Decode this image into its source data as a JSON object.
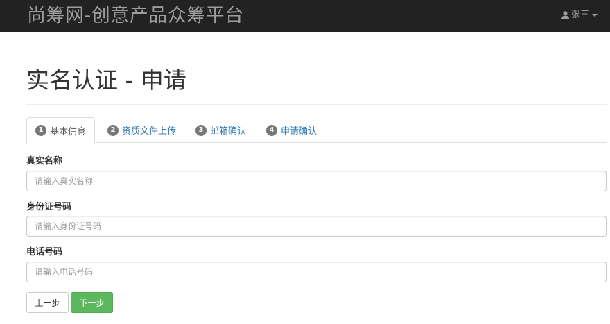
{
  "navbar": {
    "brand": "尚筹网-创意产品众筹平台",
    "user_name": "张三"
  },
  "page": {
    "title": "实名认证 - 申请"
  },
  "tabs": [
    {
      "number": "1",
      "label": "基本信息",
      "active": true
    },
    {
      "number": "2",
      "label": "资质文件上传",
      "active": false
    },
    {
      "number": "3",
      "label": "邮箱确认",
      "active": false
    },
    {
      "number": "4",
      "label": "申请确认",
      "active": false
    }
  ],
  "form": {
    "real_name": {
      "label": "真实名称",
      "placeholder": "请输入真实名称",
      "value": ""
    },
    "id_number": {
      "label": "身份证号码",
      "placeholder": "请输入身份证号码",
      "value": ""
    },
    "phone": {
      "label": "电话号码",
      "placeholder": "请输入电话号码",
      "value": ""
    }
  },
  "buttons": {
    "prev": "上一步",
    "next": "下一步"
  },
  "colors": {
    "navbar_bg": "#222222",
    "navbar_text": "#9d9d9d",
    "link": "#337ab7",
    "badge": "#777777",
    "success": "#5cb85c"
  }
}
